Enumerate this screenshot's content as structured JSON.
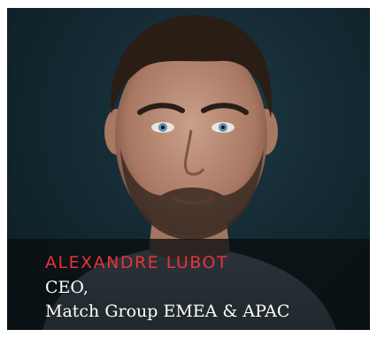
{
  "profile": {
    "name": "ALEXANDRE LUBOT",
    "title_line1": "CEO,",
    "title_line2": "Match Group EMEA & APAC"
  },
  "colors": {
    "name_accent": "#e8323c",
    "caption_text": "#ffffff",
    "background": "#142a33"
  }
}
